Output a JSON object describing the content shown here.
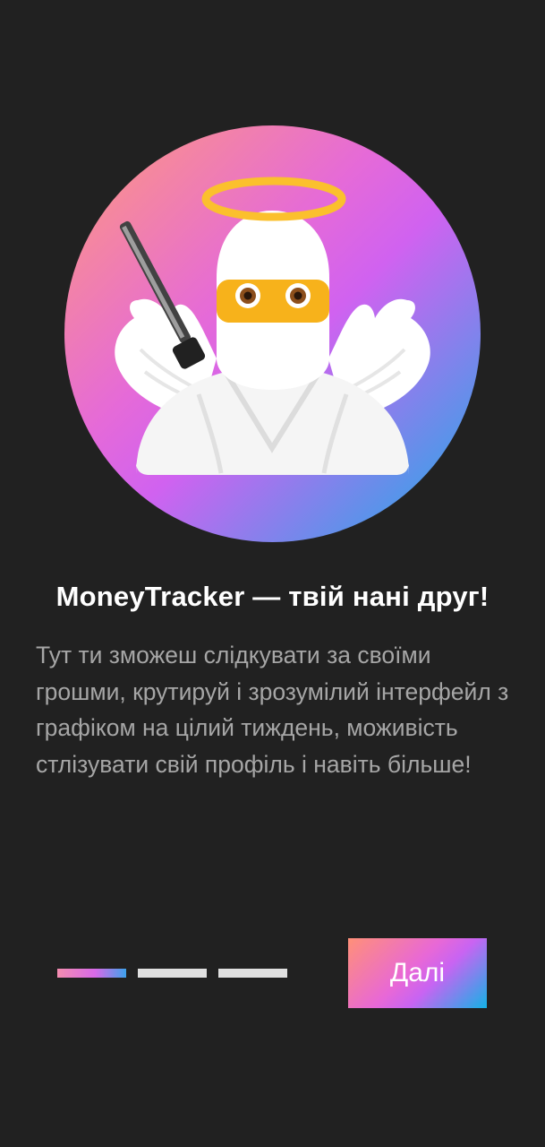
{
  "onboarding": {
    "illustration": {
      "icon": "angel-ninja-illustration",
      "gradient_colors": [
        "#ff9a7a",
        "#e56ad8",
        "#d062f0",
        "#19aee6"
      ]
    },
    "title": "MoneyTracker — твій нані друг!",
    "description": "Тут ти зможеш слідкувати за своїми грошми, крутируй і зрозумілий інтерфейл з графіком на цілий тиждень, моживість стлізувати свій профіль і навіть більше!",
    "page_indicator": {
      "current": 1,
      "total": 3
    },
    "next_button_label": "Далі"
  },
  "colors": {
    "background": "#212121",
    "title": "#ffffff",
    "description": "#a6a6a6",
    "inactive_indicator": "#e0e0e0"
  }
}
